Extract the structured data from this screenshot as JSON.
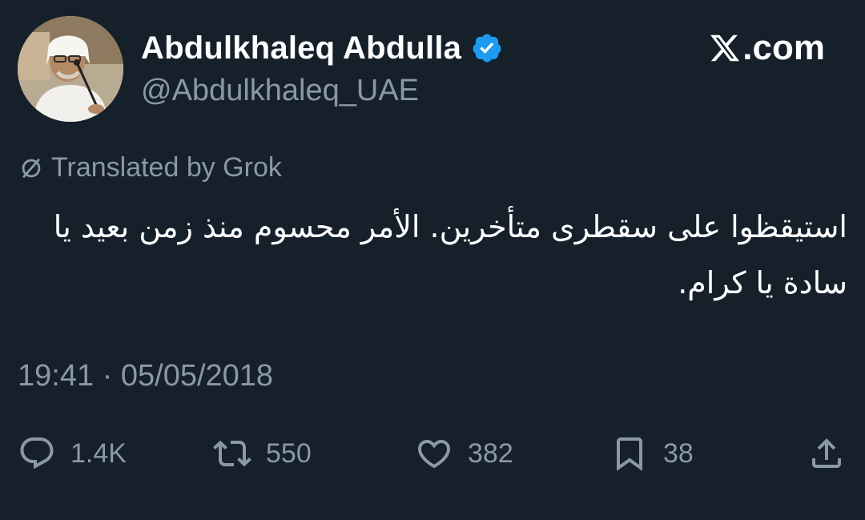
{
  "author": {
    "display_name": "Abdulkhaleq Abdulla",
    "handle": "@Abdulkhaleq_UAE",
    "verified_icon": "verified-badge-icon",
    "avatar_icon": "avatar"
  },
  "brand": {
    "label": ".com",
    "icon": "x-logo-icon"
  },
  "translation": {
    "label": "Translated by Grok",
    "icon": "translate-icon"
  },
  "tweet": {
    "text": "استيقظوا على سقطرى متأخرين. الأمر محسوم منذ زمن بعيد يا سادة يا كرام.",
    "timestamp": "19:41 · 05/05/2018"
  },
  "actions": {
    "reply": {
      "icon": "reply-icon",
      "count": "1.4K"
    },
    "retweet": {
      "icon": "retweet-icon",
      "count": "550"
    },
    "like": {
      "icon": "heart-icon",
      "count": "382"
    },
    "bookmark": {
      "icon": "bookmark-icon",
      "count": "38"
    },
    "share": {
      "icon": "share-icon"
    }
  },
  "colors": {
    "background": "#15202b",
    "text_primary": "#ffffff",
    "text_secondary": "#8b98a5",
    "verified": "#1d9bf0"
  }
}
